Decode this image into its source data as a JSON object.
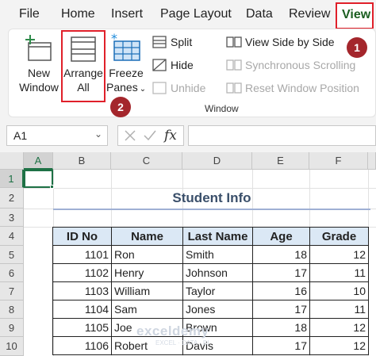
{
  "menu": {
    "items": [
      "File",
      "Home",
      "Insert",
      "Page Layout",
      "Data",
      "Review"
    ],
    "active": "View"
  },
  "ribbon": {
    "new_window": [
      "New",
      "Window"
    ],
    "arrange_all": [
      "Arrange",
      "All"
    ],
    "freeze_panes": [
      "Freeze",
      "Panes"
    ],
    "split": "Split",
    "hide": "Hide",
    "unhide": "Unhide",
    "view_side_by_side": "View Side by Side",
    "synchronous_scrolling": "Synchronous Scrolling",
    "reset_window_position": "Reset Window Position",
    "group_label": "Window"
  },
  "badges": {
    "view": "1",
    "arrange": "2"
  },
  "formula_bar": {
    "name_box": "A1",
    "fx": "fx",
    "formula": ""
  },
  "columns": [
    "A",
    "B",
    "C",
    "D",
    "E",
    "F"
  ],
  "rows": [
    "1",
    "2",
    "3",
    "4",
    "5",
    "6",
    "7",
    "8",
    "9",
    "10"
  ],
  "sheet": {
    "title": "Student Info",
    "headers": [
      "ID No",
      "Name",
      "Last Name",
      "Age",
      "Grade"
    ],
    "records": [
      [
        "1101",
        "Ron",
        "Smith",
        "18",
        "12"
      ],
      [
        "1102",
        "Henry",
        "Johnson",
        "17",
        "11"
      ],
      [
        "1103",
        "William",
        "Taylor",
        "16",
        "10"
      ],
      [
        "1104",
        "Sam",
        "Jones",
        "17",
        "11"
      ],
      [
        "1105",
        "Joe",
        "Brown",
        "18",
        "12"
      ],
      [
        "1106",
        "Robert",
        "Davis",
        "17",
        "12"
      ]
    ]
  },
  "watermark": {
    "brand": "exceldemy",
    "tagline": "EXCEL · DATA · BI"
  },
  "colors": {
    "accent_green": "#1e7145",
    "highlight_red": "#e0202a",
    "badge_red": "#a4262c",
    "header_fill": "#dbe8f5"
  }
}
